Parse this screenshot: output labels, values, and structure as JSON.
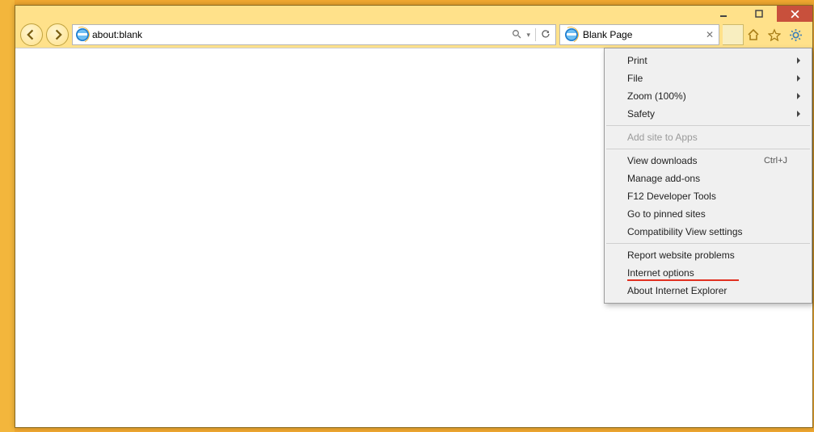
{
  "window": {
    "address": "about:blank",
    "tab_label": "Blank Page"
  },
  "menu": {
    "print": "Print",
    "file": "File",
    "zoom": "Zoom (100%)",
    "safety": "Safety",
    "add_site": "Add site to Apps",
    "view_dl": "View downloads",
    "view_dl_key": "Ctrl+J",
    "addons": "Manage add-ons",
    "f12": "F12 Developer Tools",
    "pinned": "Go to pinned sites",
    "compat": "Compatibility View settings",
    "report": "Report website problems",
    "options": "Internet options",
    "about": "About Internet Explorer"
  }
}
